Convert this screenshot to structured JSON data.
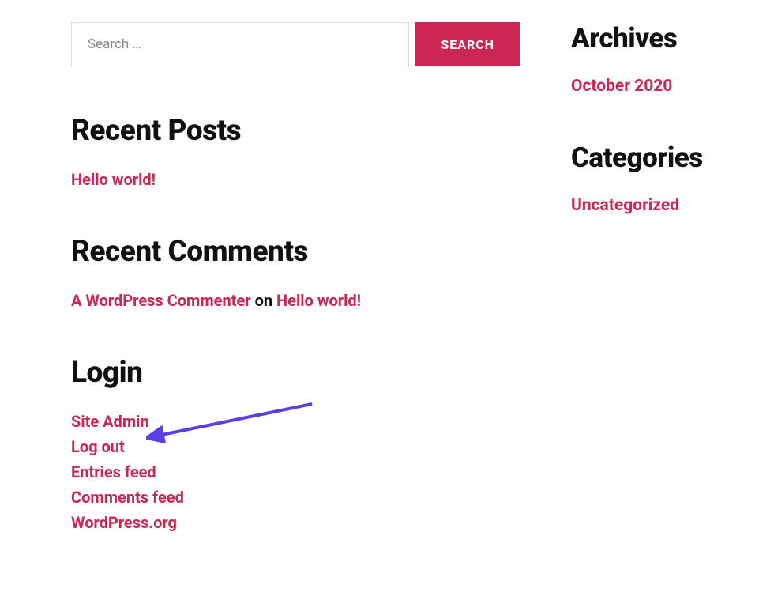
{
  "search": {
    "placeholder": "Search …",
    "button_label": "SEARCH"
  },
  "recent_posts": {
    "heading": "Recent Posts",
    "items": [
      {
        "label": "Hello world!"
      }
    ]
  },
  "recent_comments": {
    "heading": "Recent Comments",
    "items": [
      {
        "author": "A WordPress Commenter",
        "on_text": "on",
        "post": "Hello world!"
      }
    ]
  },
  "login": {
    "heading": "Login",
    "items": [
      {
        "label": "Site Admin"
      },
      {
        "label": "Log out"
      },
      {
        "label": "Entries feed"
      },
      {
        "label": "Comments feed"
      },
      {
        "label": "WordPress.org"
      }
    ]
  },
  "archives": {
    "heading": "Archives",
    "items": [
      {
        "label": "October 2020"
      }
    ]
  },
  "categories": {
    "heading": "Categories",
    "items": [
      {
        "label": "Uncategorized"
      }
    ]
  }
}
